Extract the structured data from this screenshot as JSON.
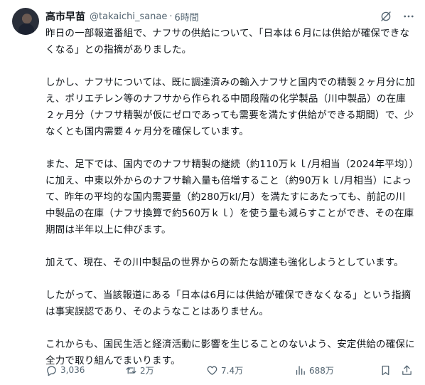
{
  "post": {
    "author_name": "高市早苗",
    "handle": "@takaichi_sanae",
    "separator": "·",
    "time": "6時間",
    "paragraphs": [
      "昨日の一部報道番組で、ナフサの供給について、「日本は６月には供給が確保できなくなる」との指摘がありました。",
      "しかし、ナフサについては、既に調達済みの輸入ナフサと国内での精製２ヶ月分に加え、ポリエチレン等のナフサから作られる中間段階の化学製品（川中製品）の在庫２ヶ月分（ナフサ精製が仮にゼロであっても需要を満たす供給ができる期間）で、少なくとも国内需要４ヶ月分を確保しています。",
      "また、足下では、国内でのナフサ精製の継続（約110万ｋｌ/月相当（2024年平均））に加え、中東以外からのナフサ輸入量も倍増すること（約90万ｋｌ/月相当）によって、昨年の平均的な国内需要量（約280万kl/月）を満たすにあたっても、前記の川中製品の在庫（ナフサ換算で約560万ｋｌ）を使う量も減らすことができ、その在庫期間は半年以上に伸びます。",
      "加えて、現在、その川中製品の世界からの新たな調達も強化しようとしています。",
      "したがって、当該報道にある「日本は6月には供給が確保できなくなる」という指摘は事実誤認であり、そのようなことはありません。",
      "これからも、国民生活と経済活動に影響を生じることのないよう、安定供給の確保に全力で取り組んでまいります。"
    ]
  },
  "actions": {
    "reply_count": "3,036",
    "repost_count": "2万",
    "like_count": "7.4万",
    "view_count": "688万"
  },
  "icons": {
    "grok": "grok-icon",
    "more": "more-icon",
    "reply": "reply-icon",
    "repost": "repost-icon",
    "like": "like-icon",
    "views": "views-icon",
    "bookmark": "bookmark-icon",
    "share": "share-icon"
  },
  "colors": {
    "text": "#0f1419",
    "secondary": "#536471",
    "background": "#ffffff"
  }
}
